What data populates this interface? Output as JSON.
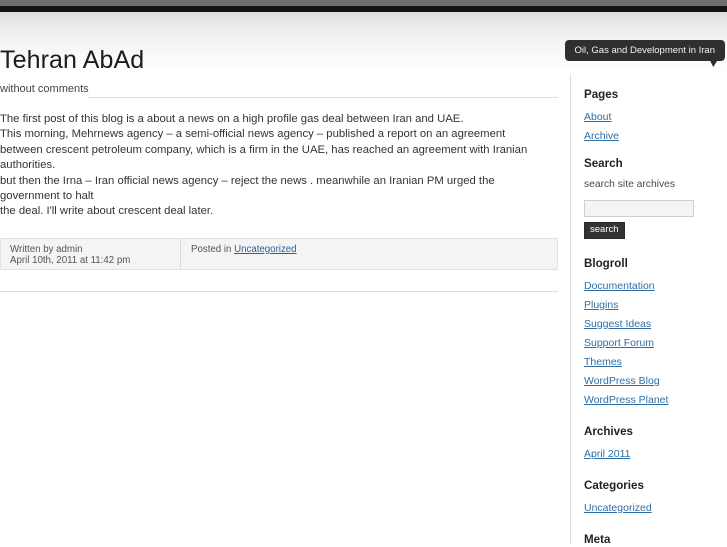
{
  "site": {
    "title": "Tehran AbAd",
    "description": "Oil, Gas and Development in Iran"
  },
  "post": {
    "comments_label": "without comments",
    "body_lines": [
      "The first post of this blog is a about a news on a high profile gas deal between Iran and UAE.",
      "This morning, Mehrnews agency – a semi-official news agency – published a report on an agreement",
      "between crescent petroleum company, which is a firm in the UAE, has reached an agreement with Iranian authorities.",
      "but then the Irna – Iran official news agency – reject the news . meanwhile an Iranian PM urged the government to halt",
      "the deal. I'll write about crescent deal later."
    ],
    "meta": {
      "author_line": "Written by admin",
      "date_line": "April 10th, 2011 at 11:42 pm",
      "posted_in_label": "Posted in ",
      "category": "Uncategorized"
    }
  },
  "sidebar": {
    "pages": {
      "title": "Pages",
      "items": [
        {
          "label": "About"
        },
        {
          "label": "Archive"
        }
      ]
    },
    "search": {
      "title": "Search",
      "description": "search site archives",
      "input_value": "",
      "input_placeholder": "",
      "button_label": "search"
    },
    "blogroll": {
      "title": "Blogroll",
      "items": [
        {
          "label": "Documentation"
        },
        {
          "label": "Plugins"
        },
        {
          "label": "Suggest Ideas"
        },
        {
          "label": "Support Forum"
        },
        {
          "label": "Themes"
        },
        {
          "label": "WordPress Blog"
        },
        {
          "label": "WordPress Planet"
        }
      ]
    },
    "archives": {
      "title": "Archives",
      "items": [
        {
          "label": "April 2011"
        }
      ]
    },
    "categories": {
      "title": "Categories",
      "items": [
        {
          "label": "Uncategorized"
        }
      ]
    },
    "meta": {
      "title": "Meta"
    }
  },
  "colors": {
    "link": "#2f6ea5",
    "header_bubble": "#2f2f2f",
    "top_bar": "#6e6e6e",
    "meta_box_bg": "#f4f4f4"
  }
}
